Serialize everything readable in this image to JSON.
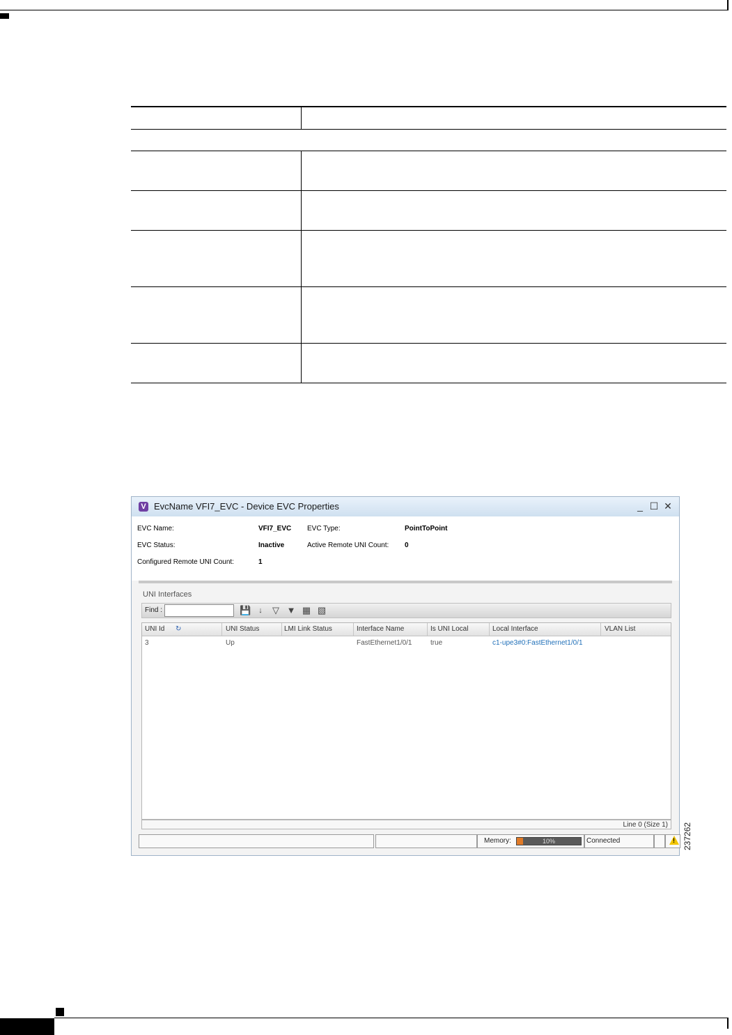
{
  "window": {
    "title": "EvcName VFI7_EVC - Device EVC Properties",
    "app_icon": "V",
    "controls": {
      "minimize": "_",
      "maximize": "☐",
      "close": "✕"
    }
  },
  "properties": {
    "evc_name_label": "EVC Name:",
    "evc_name_value": "VFI7_EVC",
    "evc_type_label": "EVC Type:",
    "evc_type_value": "PointToPoint",
    "evc_status_label": "EVC Status:",
    "evc_status_value": "Inactive",
    "active_remote_label": "Active Remote UNI Count:",
    "active_remote_value": "0",
    "configured_remote_label": "Configured Remote UNI Count:",
    "configured_remote_value": "1"
  },
  "uni_section": {
    "title": "UNI Interfaces",
    "find_label": "Find :",
    "find_value": "",
    "toolbar_icons": [
      "save-icon",
      "sort-icon",
      "filter-icon",
      "advanced-filter-icon",
      "export-icon",
      "columns-icon"
    ],
    "columns": [
      "UNI Id",
      "UNI Status",
      "LMI Link Status",
      "Interface Name",
      "Is UNI Local",
      "Local Interface",
      "VLAN List"
    ],
    "rows": [
      {
        "uni_id": "3",
        "uni_status": "Up",
        "lmi_link_status": "",
        "interface_name": "FastEthernet1/0/1",
        "is_uni_local": "true",
        "local_interface": "c1-upe3#0:FastEthernet1/0/1",
        "vlan_list": ""
      }
    ],
    "line_info": "Line 0 (Size 1)"
  },
  "status_bar": {
    "memory_label": "Memory:",
    "memory_percent": 10,
    "memory_text": "10%",
    "connection": "Connected"
  },
  "figure_id": "237262",
  "colors": {
    "link": "#1f6fb8",
    "memory_fill": "#e07a27",
    "warning": "#f2c500"
  }
}
